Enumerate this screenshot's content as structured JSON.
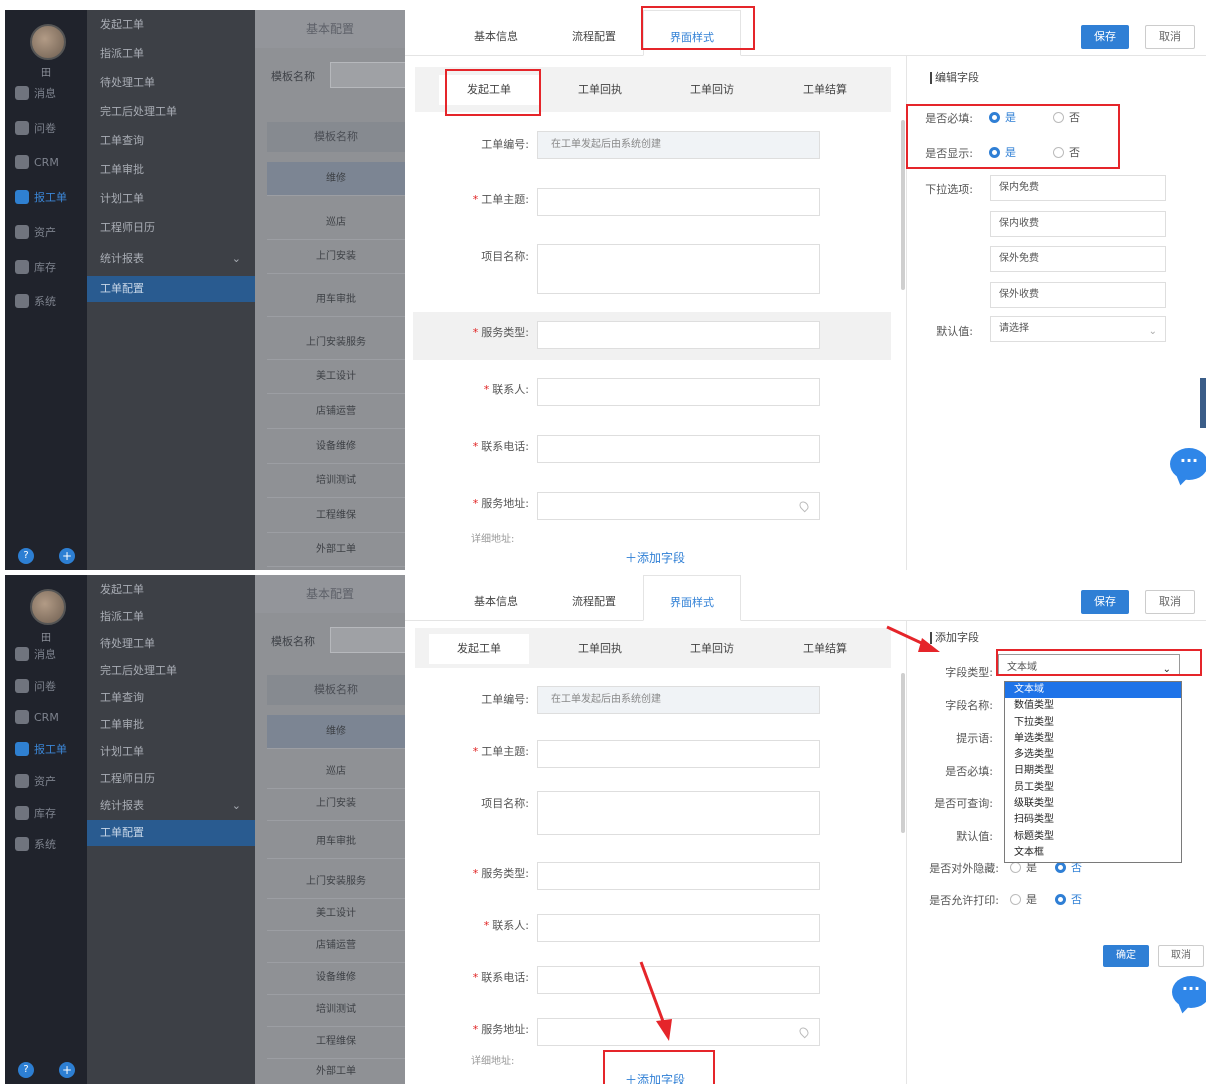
{
  "user": {
    "name": "田"
  },
  "nav": {
    "items": [
      {
        "label": "消息",
        "icon": "message-icon"
      },
      {
        "label": "问卷",
        "icon": "survey-icon"
      },
      {
        "label": "CRM",
        "icon": "crm-icon"
      },
      {
        "label": "报工单",
        "icon": "workorder-icon"
      },
      {
        "label": "资产",
        "icon": "asset-icon"
      },
      {
        "label": "库存",
        "icon": "inventory-icon"
      },
      {
        "label": "系统",
        "icon": "gear-icon"
      }
    ],
    "help": "?",
    "plus": "+"
  },
  "menu2": {
    "items": [
      "发起工单",
      "指派工单",
      "待处理工单",
      "完工后处理工单",
      "工单查询",
      "工单审批",
      "计划工单",
      "工程师日历",
      "统计报表",
      "工单配置"
    ],
    "chevron": "⌄"
  },
  "template_list": {
    "header": "基本配置",
    "name_label": "模板名称",
    "column": "模板名称",
    "rows": [
      "维修",
      "巡店",
      "上门安装",
      "用车审批",
      "上门安装服务",
      "美工设计",
      "店铺运营",
      "设备维修",
      "培训测试",
      "工程维保",
      "外部工单"
    ]
  },
  "tabs": [
    "基本信息",
    "流程配置",
    "界面样式"
  ],
  "buttons": {
    "save": "保存",
    "cancel": "取消"
  },
  "subtabs": [
    "发起工单",
    "工单回执",
    "工单回访",
    "工单结算"
  ],
  "form": {
    "fields": [
      {
        "label": "工单编号:",
        "required": false,
        "value": "在工单发起后由系统创建"
      },
      {
        "label": "工单主题:",
        "required": true,
        "value": ""
      },
      {
        "label": "项目名称:",
        "required": false,
        "value": ""
      },
      {
        "label": "服务类型:",
        "required": true,
        "value": ""
      },
      {
        "label": "联系人:",
        "required": true,
        "value": ""
      },
      {
        "label": "联系电话:",
        "required": true,
        "value": ""
      },
      {
        "label": "服务地址:",
        "required": true,
        "value": ""
      }
    ],
    "req_mark": "*",
    "cut_label": "详细地址:",
    "add_field": "＋添加字段"
  },
  "edit_panel": {
    "title": "编辑字段",
    "required_label": "是否必填:",
    "display_label": "是否显示:",
    "yes": "是",
    "no": "否",
    "options_label": "下拉选项:",
    "options": [
      "保内免费",
      "保内收费",
      "保外免费",
      "保外收费"
    ],
    "default_label": "默认值:",
    "default_placeholder": "请选择"
  },
  "add_panel": {
    "title": "添加字段",
    "type_label": "字段类型:",
    "type_value": "文本域",
    "name_label": "字段名称:",
    "hint_label": "提示语:",
    "required_label": "是否必填:",
    "query_label": "是否可查询:",
    "default_label": "默认值:",
    "hidden_label": "是否对外隐藏:",
    "print_label": "是否允许打印:",
    "yes": "是",
    "no": "否",
    "type_options": [
      "文本域",
      "数值类型",
      "下拉类型",
      "单选类型",
      "多选类型",
      "日期类型",
      "员工类型",
      "级联类型",
      "扫码类型",
      "标题类型",
      "文本框"
    ],
    "ok": "确定",
    "cancel": "取消"
  },
  "chat": "···",
  "colors": {
    "accent": "#2f7fd5",
    "annotation": "#e5252a",
    "nav_bg": "#20232c"
  }
}
